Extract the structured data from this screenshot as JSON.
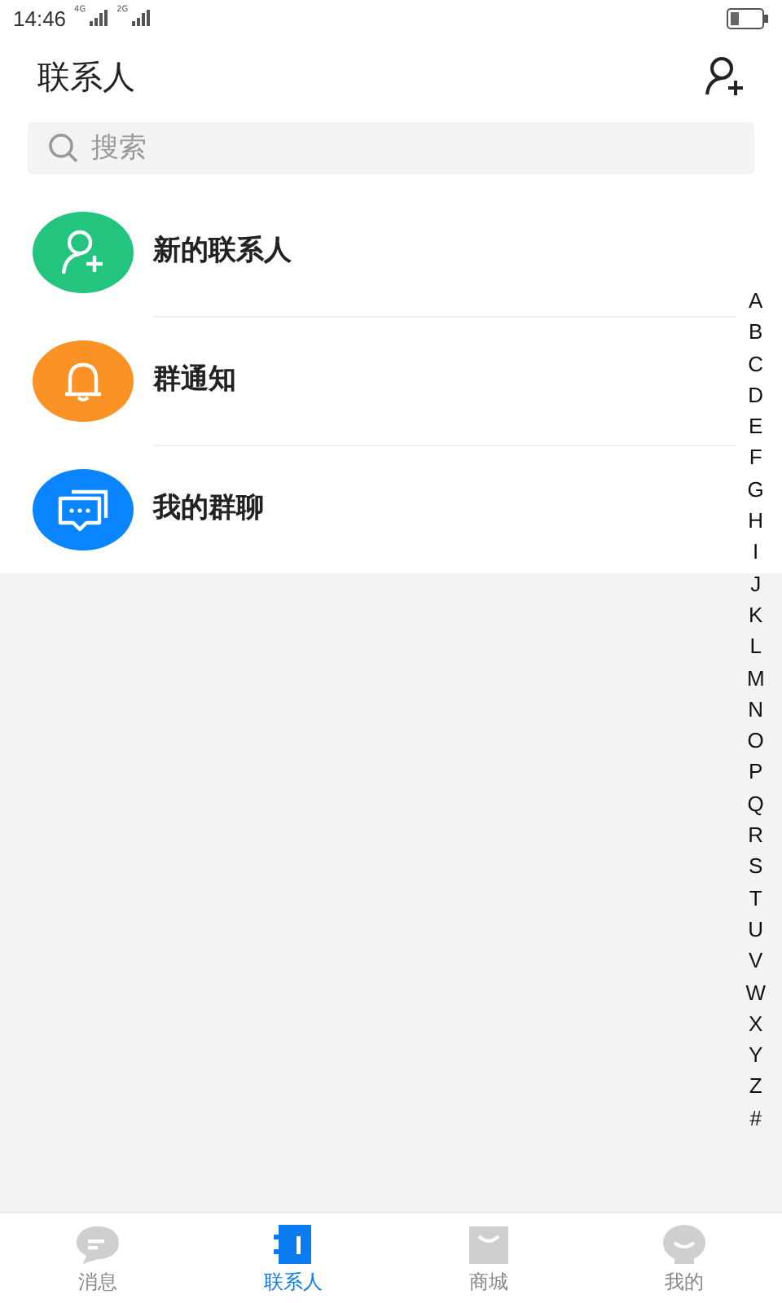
{
  "status_bar": {
    "time": "14:46",
    "networks": [
      "4G",
      "2G"
    ]
  },
  "header": {
    "title": "联系人"
  },
  "search": {
    "placeholder": "搜索"
  },
  "entries": [
    {
      "kind": "add-contact",
      "label": "新的联系人",
      "color": "#22c47e"
    },
    {
      "kind": "notification",
      "label": "群通知",
      "color": "#fb9226"
    },
    {
      "kind": "group-chat",
      "label": "我的群聊",
      "color": "#0a84ff"
    }
  ],
  "index_letters": [
    "A",
    "B",
    "C",
    "D",
    "E",
    "F",
    "G",
    "H",
    "I",
    "J",
    "K",
    "L",
    "M",
    "N",
    "O",
    "P",
    "Q",
    "R",
    "S",
    "T",
    "U",
    "V",
    "W",
    "X",
    "Y",
    "Z",
    "#"
  ],
  "tabs": [
    {
      "kind": "messages",
      "label": "消息",
      "selected": false
    },
    {
      "kind": "contacts",
      "label": "联系人",
      "selected": true
    },
    {
      "kind": "shop",
      "label": "商城",
      "selected": false
    },
    {
      "kind": "me",
      "label": "我的",
      "selected": false
    }
  ]
}
